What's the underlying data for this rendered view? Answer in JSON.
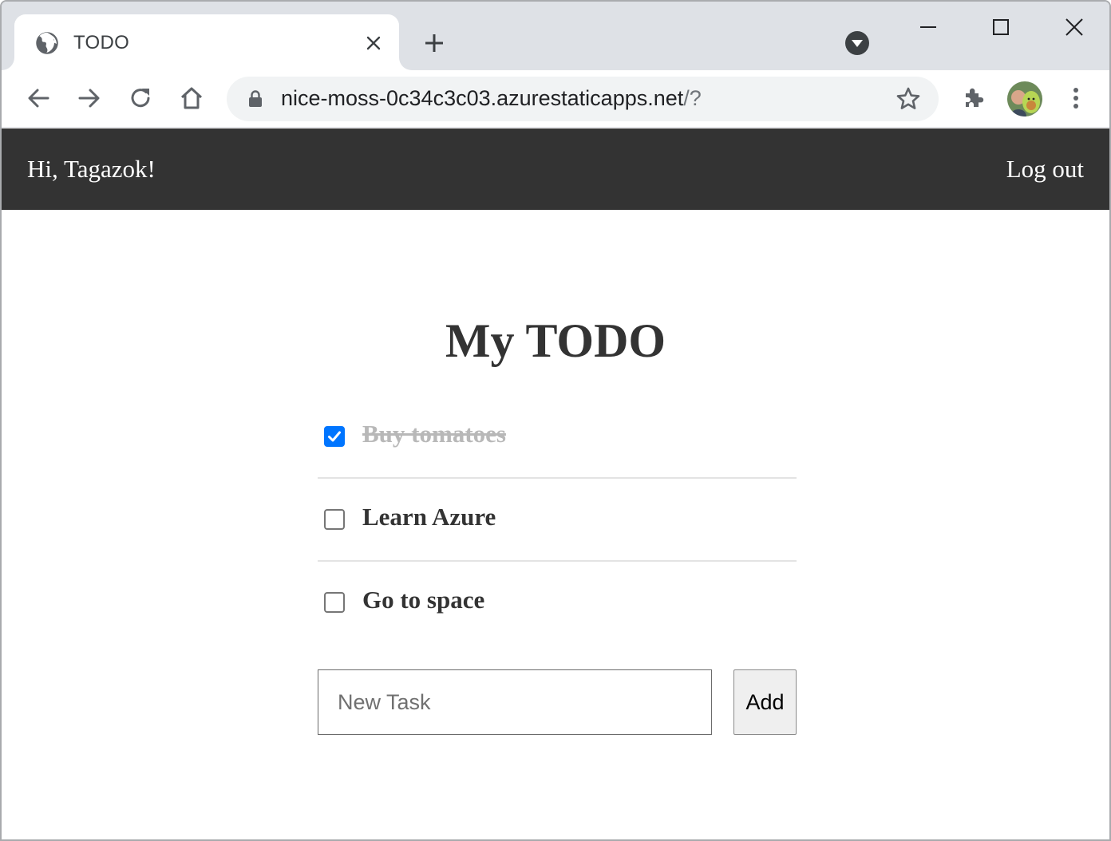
{
  "browser": {
    "tab_title": "TODO",
    "url_host": "nice-moss-0c34c3c03.azurestaticapps.net",
    "url_path": "/?"
  },
  "header": {
    "greeting": "Hi, Tagazok!",
    "logout_label": "Log out"
  },
  "todo": {
    "title": "My TODO",
    "items": [
      {
        "label": "Buy tomatoes",
        "done": true
      },
      {
        "label": "Learn Azure",
        "done": false
      },
      {
        "label": "Go to space",
        "done": false
      }
    ],
    "new_task_placeholder": "New Task",
    "add_label": "Add"
  },
  "colors": {
    "header_bg": "#333333",
    "checkbox_accent": "#0075ff",
    "tabstrip_bg": "#dee1e6"
  }
}
